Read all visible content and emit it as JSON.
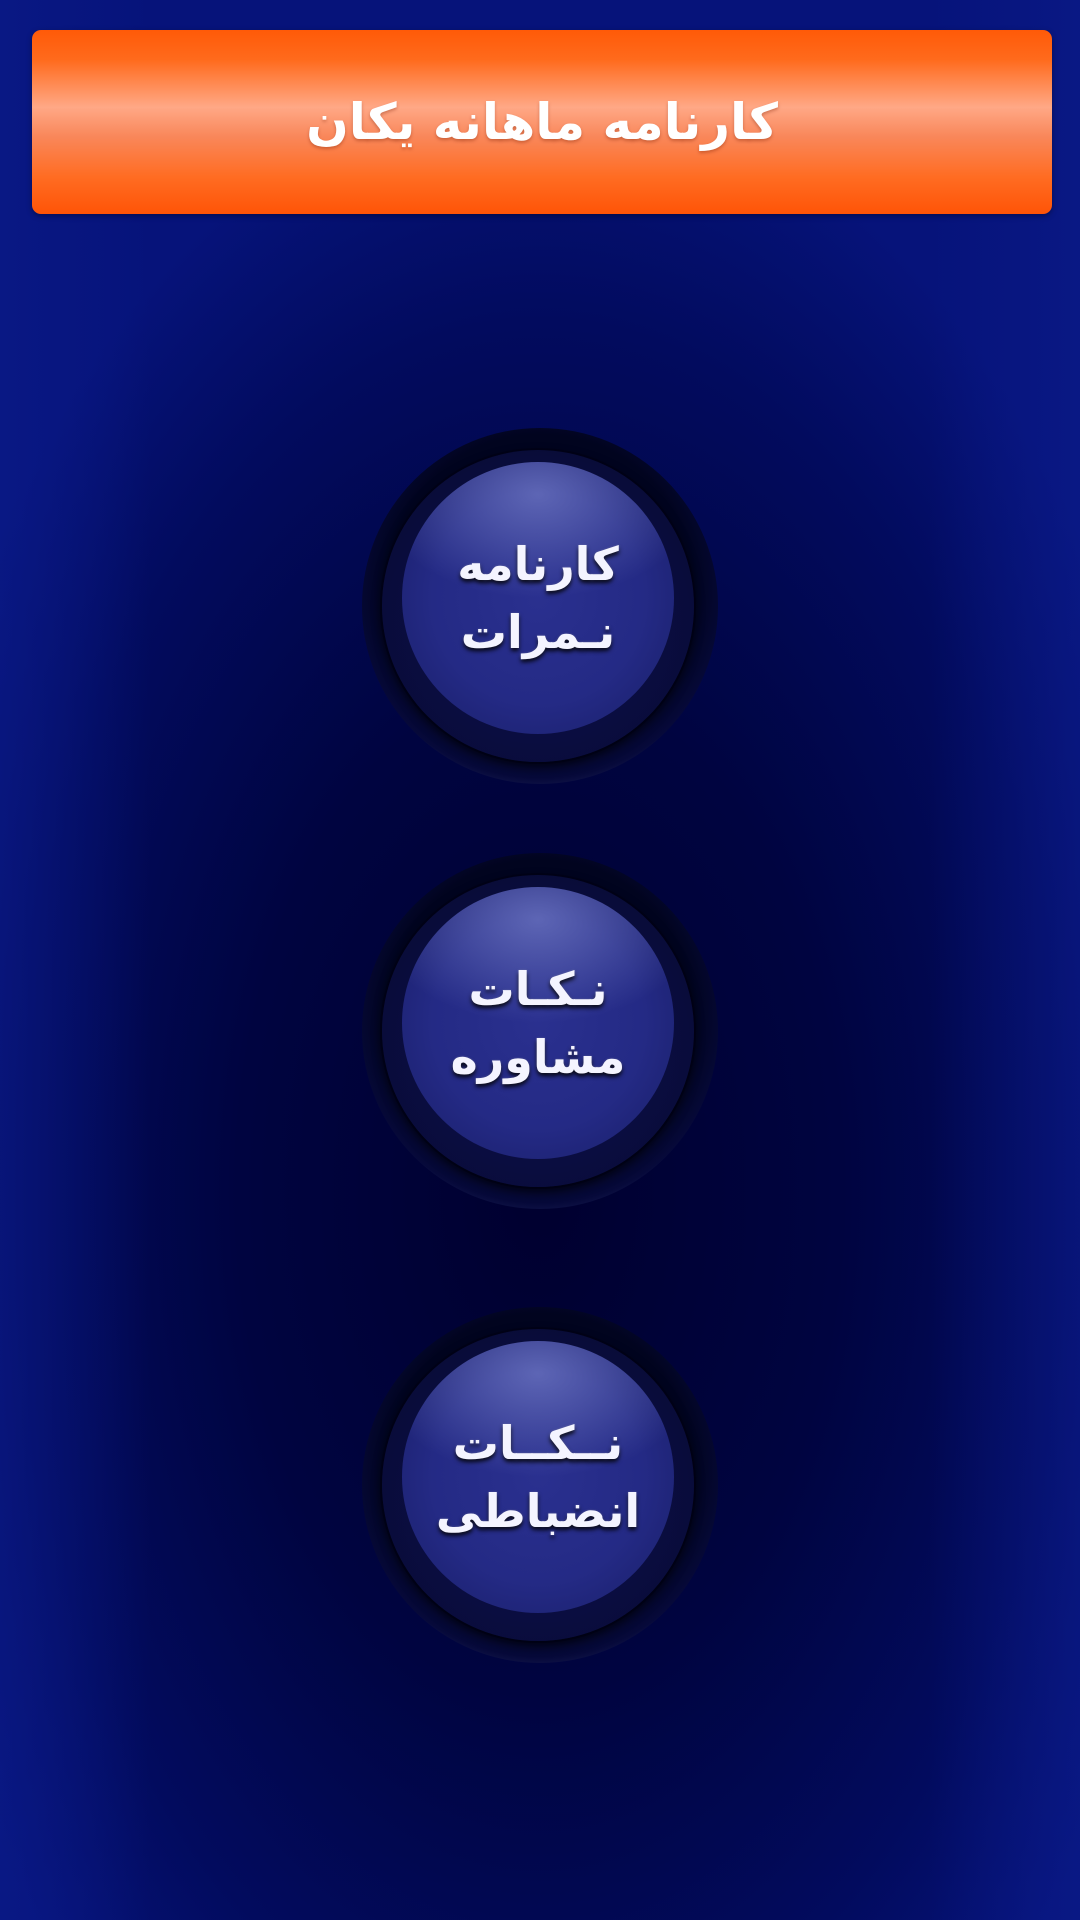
{
  "header": {
    "title": "کارنامه ماهانه یکان"
  },
  "buttons": [
    {
      "line1": "کارنامه",
      "line2": "نـمرات"
    },
    {
      "line1": "نـکـات",
      "line2": "مشاوره"
    },
    {
      "line1": "نــکــات",
      "line2": "انضباطی"
    }
  ],
  "colors": {
    "header_orange": "#ff5a08",
    "background_navy": "#000440",
    "button_face": "#242a85"
  }
}
